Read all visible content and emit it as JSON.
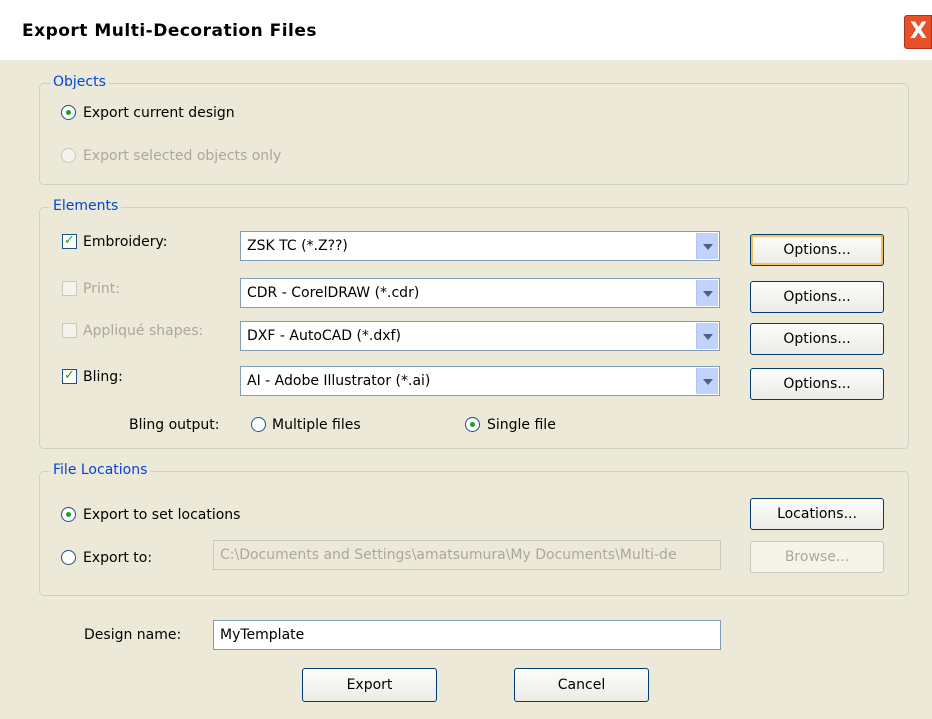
{
  "window": {
    "title": "Export Multi-Decoration Files",
    "close_label": "X"
  },
  "objects": {
    "legend": "Objects",
    "current_design": {
      "label": "Export current design",
      "selected": true
    },
    "selected_only": {
      "label": "Export selected objects only",
      "selected": false,
      "enabled": false
    }
  },
  "elements": {
    "legend": "Elements",
    "rows": [
      {
        "label": "Embroidery:",
        "checked": true,
        "enabled": true,
        "format": "ZSK TC (*.Z??)",
        "button": "Options..."
      },
      {
        "label": "Print:",
        "checked": false,
        "enabled": false,
        "format": "CDR - CorelDRAW (*.cdr)",
        "button": "Options..."
      },
      {
        "label": "Appliqué shapes:",
        "checked": false,
        "enabled": false,
        "format": "DXF - AutoCAD (*.dxf)",
        "button": "Options..."
      },
      {
        "label": "Bling:",
        "checked": true,
        "enabled": true,
        "format": "AI - Adobe Illustrator (*.ai)",
        "button": "Options..."
      }
    ],
    "bling_output": {
      "label": "Bling output:",
      "multiple": {
        "label": "Multiple files",
        "selected": false
      },
      "single": {
        "label": "Single file",
        "selected": true
      }
    }
  },
  "file_locations": {
    "legend": "File Locations",
    "set_locations": {
      "label": "Export to set locations",
      "selected": true
    },
    "locations_button": "Locations...",
    "export_to": {
      "label": "Export to:",
      "selected": false
    },
    "path": "C:\\Documents and Settings\\amatsumura\\My Documents\\Multi-de",
    "browse_button": "Browse..."
  },
  "design_name": {
    "label": "Design name:",
    "value": "MyTemplate"
  },
  "buttons": {
    "export": "Export",
    "cancel": "Cancel"
  }
}
